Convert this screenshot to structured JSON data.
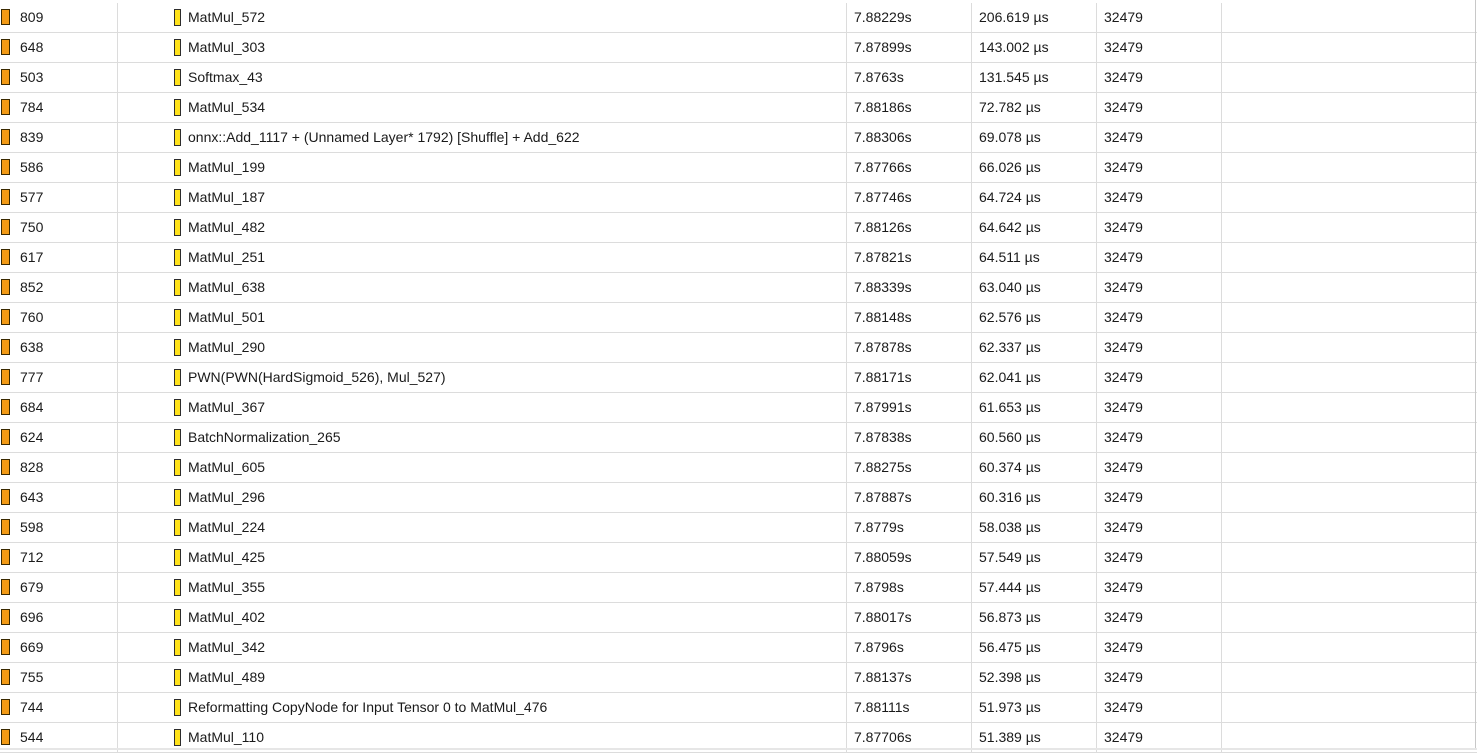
{
  "table": {
    "rows": [
      {
        "id": "809",
        "name": "MatMul_572",
        "start": "7.88229s",
        "duration": "206.619 µs",
        "count": "32479"
      },
      {
        "id": "648",
        "name": "MatMul_303",
        "start": "7.87899s",
        "duration": "143.002 µs",
        "count": "32479"
      },
      {
        "id": "503",
        "name": "Softmax_43",
        "start": "7.8763s",
        "duration": "131.545 µs",
        "count": "32479"
      },
      {
        "id": "784",
        "name": "MatMul_534",
        "start": "7.88186s",
        "duration": "72.782 µs",
        "count": "32479"
      },
      {
        "id": "839",
        "name": "onnx::Add_1117 + (Unnamed Layer* 1792) [Shuffle] + Add_622",
        "start": "7.88306s",
        "duration": "69.078 µs",
        "count": "32479"
      },
      {
        "id": "586",
        "name": "MatMul_199",
        "start": "7.87766s",
        "duration": "66.026 µs",
        "count": "32479"
      },
      {
        "id": "577",
        "name": "MatMul_187",
        "start": "7.87746s",
        "duration": "64.724 µs",
        "count": "32479"
      },
      {
        "id": "750",
        "name": "MatMul_482",
        "start": "7.88126s",
        "duration": "64.642 µs",
        "count": "32479"
      },
      {
        "id": "617",
        "name": "MatMul_251",
        "start": "7.87821s",
        "duration": "64.511 µs",
        "count": "32479"
      },
      {
        "id": "852",
        "name": "MatMul_638",
        "start": "7.88339s",
        "duration": "63.040 µs",
        "count": "32479"
      },
      {
        "id": "760",
        "name": "MatMul_501",
        "start": "7.88148s",
        "duration": "62.576 µs",
        "count": "32479"
      },
      {
        "id": "638",
        "name": "MatMul_290",
        "start": "7.87878s",
        "duration": "62.337 µs",
        "count": "32479"
      },
      {
        "id": "777",
        "name": "PWN(PWN(HardSigmoid_526), Mul_527)",
        "start": "7.88171s",
        "duration": "62.041 µs",
        "count": "32479"
      },
      {
        "id": "684",
        "name": "MatMul_367",
        "start": "7.87991s",
        "duration": "61.653 µs",
        "count": "32479"
      },
      {
        "id": "624",
        "name": "BatchNormalization_265",
        "start": "7.87838s",
        "duration": "60.560 µs",
        "count": "32479"
      },
      {
        "id": "828",
        "name": "MatMul_605",
        "start": "7.88275s",
        "duration": "60.374 µs",
        "count": "32479"
      },
      {
        "id": "643",
        "name": "MatMul_296",
        "start": "7.87887s",
        "duration": "60.316 µs",
        "count": "32479"
      },
      {
        "id": "598",
        "name": "MatMul_224",
        "start": "7.8779s",
        "duration": "58.038 µs",
        "count": "32479"
      },
      {
        "id": "712",
        "name": "MatMul_425",
        "start": "7.88059s",
        "duration": "57.549 µs",
        "count": "32479"
      },
      {
        "id": "679",
        "name": "MatMul_355",
        "start": "7.8798s",
        "duration": "57.444 µs",
        "count": "32479"
      },
      {
        "id": "696",
        "name": "MatMul_402",
        "start": "7.88017s",
        "duration": "56.873 µs",
        "count": "32479"
      },
      {
        "id": "669",
        "name": "MatMul_342",
        "start": "7.8796s",
        "duration": "56.475 µs",
        "count": "32479"
      },
      {
        "id": "755",
        "name": "MatMul_489",
        "start": "7.88137s",
        "duration": "52.398 µs",
        "count": "32479"
      },
      {
        "id": "744",
        "name": "Reformatting CopyNode for Input Tensor 0 to MatMul_476",
        "start": "7.88111s",
        "duration": "51.973 µs",
        "count": "32479"
      },
      {
        "id": "544",
        "name": "MatMul_110",
        "start": "7.87706s",
        "duration": "51.389 µs",
        "count": "32479"
      }
    ]
  },
  "colors": {
    "id_marker": "#f39a14",
    "name_marker": "#ffe21a",
    "grid": "#dcdcdc"
  },
  "icons": {
    "id_marker": "orange-range-marker-icon",
    "name_marker": "yellow-range-marker-icon"
  }
}
